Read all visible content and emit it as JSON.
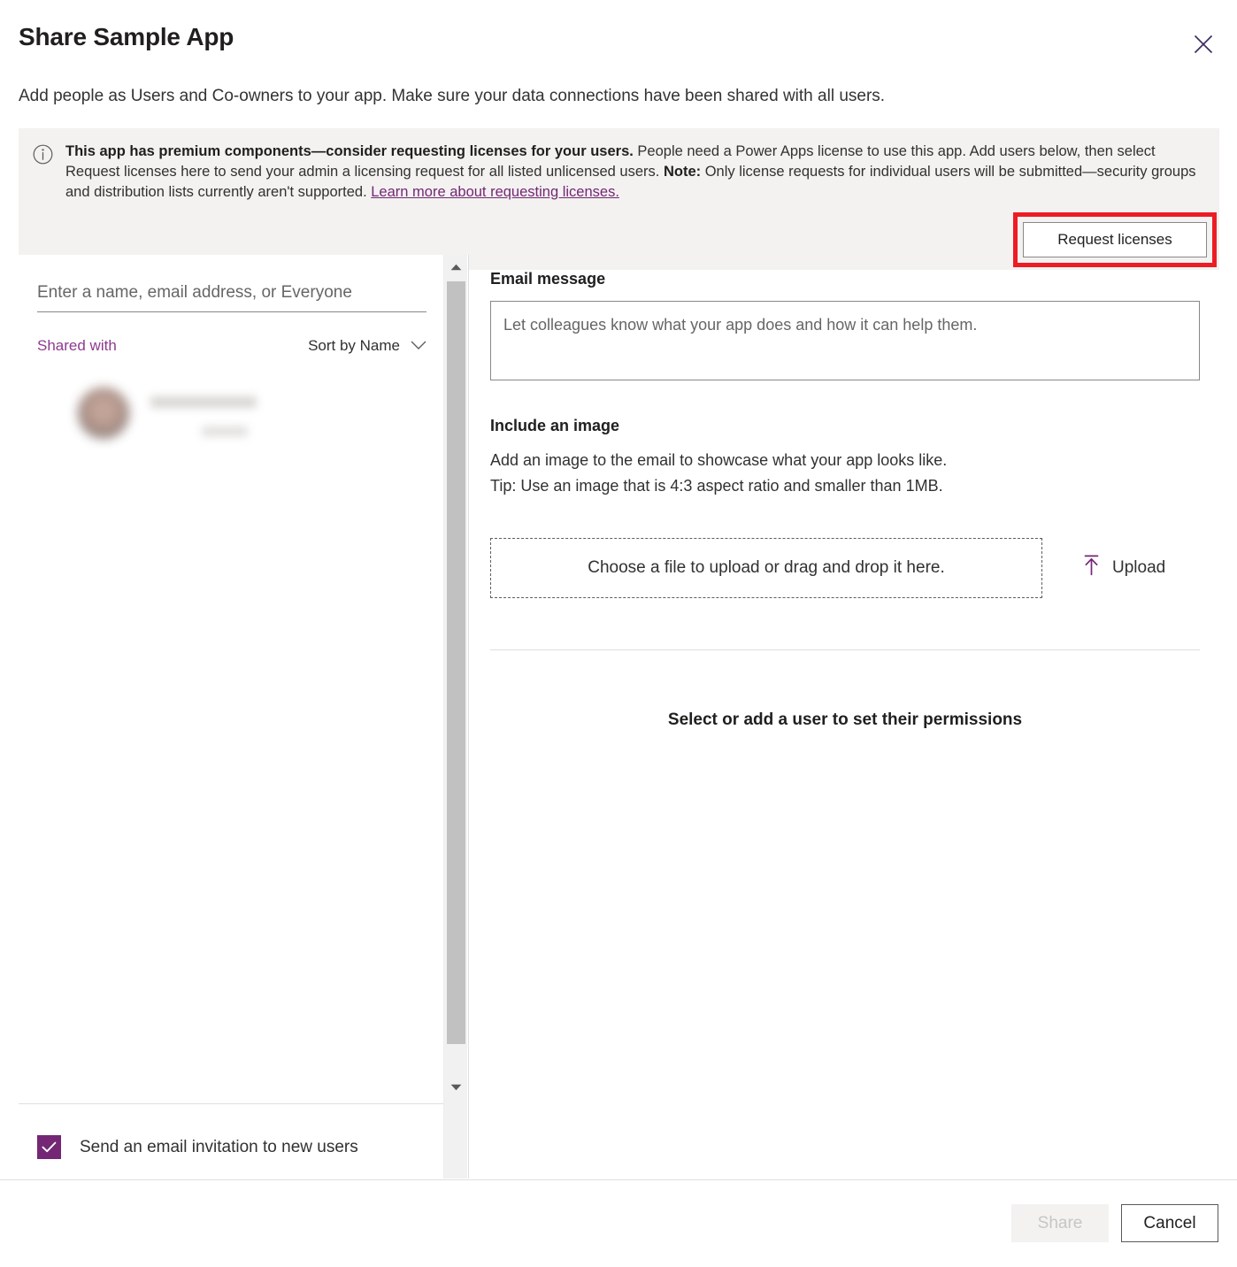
{
  "dialog": {
    "title": "Share Sample App",
    "subtitle": "Add people as Users and Co-owners to your app. Make sure your data connections have been shared with all users.",
    "close_icon": "close-icon"
  },
  "banner": {
    "icon": "info-icon",
    "bold_lead": "This app has premium components—consider requesting licenses for your users.",
    "body_part1": " People need a Power Apps license to use this app. Add users below, then select Request licenses here to send your admin a licensing request for all listed unlicensed users. ",
    "note_label": "Note:",
    "body_part2": " Only license requests for individual users will be submitted—security groups and distribution lists currently aren't supported. ",
    "link_text": "Learn more about requesting licenses.",
    "request_licenses_label": "Request licenses",
    "highlight_color": "#ed1c24",
    "background_color": "#f3f2f1"
  },
  "left_panel": {
    "people_picker_placeholder": "Enter a name, email address, or Everyone",
    "people_picker_value": "",
    "shared_with_label": "Shared with",
    "sort_label": "Sort by Name",
    "sort_chevron_icon": "chevron-down-icon",
    "shared_users": [
      {
        "name": "",
        "subtitle": "",
        "redacted": true
      }
    ],
    "send_invite_label": "Send an email invitation to new users",
    "send_invite_checked": true,
    "checkbox_color": "#742774",
    "accent_color": "#8e3a8e",
    "scroll_up_icon": "scroll-up-arrow-icon",
    "scroll_down_icon": "scroll-down-arrow-icon"
  },
  "right_panel": {
    "email_message_title": "Email message",
    "email_message_placeholder": "Let colleagues know what your app does and how it can help them.",
    "email_message_value": "",
    "include_image_title": "Include an image",
    "include_image_line1": "Add an image to the email to showcase what your app looks like.",
    "include_image_line2": "Tip: Use an image that is 4:3 aspect ratio and smaller than 1MB.",
    "dropzone_label": "Choose a file to upload or drag and drop it here.",
    "upload_label": "Upload",
    "upload_icon": "upload-arrow-icon",
    "permissions_empty_text": "Select or add a user to set their permissions"
  },
  "footer": {
    "share_label": "Share",
    "share_disabled": true,
    "cancel_label": "Cancel"
  }
}
